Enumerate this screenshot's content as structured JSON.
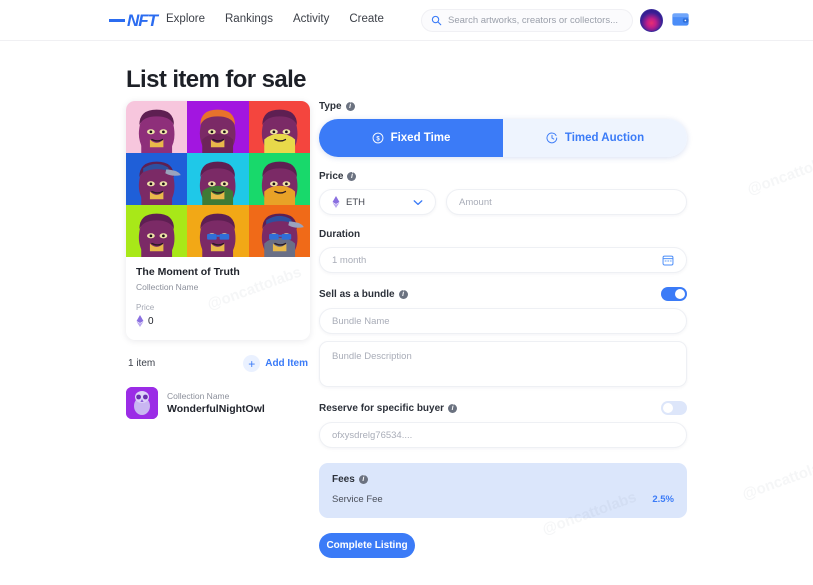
{
  "header": {
    "logo": "NFT",
    "nav": [
      {
        "label": "Explore"
      },
      {
        "label": "Rankings"
      },
      {
        "label": "Activity"
      },
      {
        "label": "Create"
      }
    ],
    "search": {
      "placeholder": "Search artworks, creators or collectors...",
      "value": ""
    },
    "icons": {
      "search": "search-icon",
      "avatar": "avatar",
      "wallet": "wallet-icon"
    }
  },
  "page_title": "List item for sale",
  "card": {
    "title": "The Moment of Truth",
    "collection": "Collection Name",
    "price_label": "Price",
    "price_value": "0",
    "tiles": [
      {
        "bg": "#f7c6dd",
        "skin": "#8e2f7a",
        "hair": "#5e1f52",
        "shirt": "#8e2f7a",
        "accent": "#e8b94a",
        "hat": null,
        "glasses": null
      },
      {
        "bg": "#a216e0",
        "skin": "#7b2a66",
        "hair": "#e8722c",
        "shirt": "#6d2459",
        "accent": "#e8b94a",
        "hat": null,
        "glasses": null
      },
      {
        "bg": "#f4453e",
        "skin": "#7b2a66",
        "hair": "#5e1f52",
        "shirt": "#e8d94a",
        "accent": "#e8d94a",
        "hat": null,
        "glasses": null
      },
      {
        "bg": "#1f5fd8",
        "skin": "#7b2a66",
        "hair": "#5e1f52",
        "shirt": "#7b2a66",
        "accent": "#e8b94a",
        "hat": "#2f4f9e",
        "glasses": null
      },
      {
        "bg": "#1fc8e8",
        "skin": "#7b2a66",
        "hair": "#5e1f52",
        "shirt": "#3f7a35",
        "accent": "#e8b94a",
        "hat": null,
        "glasses": null
      },
      {
        "bg": "#18d96b",
        "skin": "#7b2a66",
        "hair": "#5e1f52",
        "shirt": "#e8a227",
        "accent": "#e8a227",
        "hat": null,
        "glasses": null
      },
      {
        "bg": "#a8e818",
        "skin": "#7b2a66",
        "hair": "#5e1f52",
        "shirt": "#7b2a66",
        "accent": "#e8b94a",
        "hat": null,
        "glasses": null
      },
      {
        "bg": "#f2a816",
        "skin": "#7b2a66",
        "hair": "#5e1f52",
        "shirt": "#7b2a66",
        "accent": "#e8b94a",
        "hat": null,
        "glasses": "#2f6fd8"
      },
      {
        "bg": "#f06a18",
        "skin": "#7b2a66",
        "hair": "#5e1f52",
        "shirt": "#6a6f86",
        "accent": "#e8b94a",
        "hat": "#2f4f9e",
        "glasses": "#2f6fd8"
      }
    ]
  },
  "items": {
    "count_label": "1 item",
    "add_label": "Add Item",
    "add_icon": "plus-icon",
    "list": [
      {
        "collection": "Collection Name",
        "name": "WonderfulNightOwl"
      }
    ]
  },
  "form": {
    "type": {
      "label": "Type",
      "options": [
        {
          "label": "Fixed Time",
          "icon": "dollar-circle-icon",
          "active": true
        },
        {
          "label": "Timed Auction",
          "icon": "clock-icon",
          "active": false
        }
      ]
    },
    "price": {
      "label": "Price",
      "currency": "ETH",
      "currency_icon": "ethereum-icon",
      "chevron_icon": "chevron-down-icon",
      "amount_placeholder": "Amount",
      "amount_value": ""
    },
    "duration": {
      "label": "Duration",
      "placeholder": "1 month",
      "value": "",
      "icon": "calendar-icon"
    },
    "bundle": {
      "label": "Sell as a bundle",
      "toggle_on": true,
      "name_placeholder": "Bundle Name",
      "name_value": "",
      "description_placeholder": "Bundle Description",
      "description_value": ""
    },
    "reserve": {
      "label": "Reserve for specific buyer",
      "toggle_on": false,
      "address_placeholder": "ofxysdrelg76534....",
      "address_value": ""
    },
    "fees": {
      "label": "Fees",
      "rows": [
        {
          "name": "Service Fee",
          "value": "2.5%"
        }
      ]
    },
    "submit_label": "Complete Listing"
  },
  "colors": {
    "accent": "#3b7bf7",
    "accent_light": "#eef4fe",
    "fees_bg": "#dbe6fb",
    "text_dark": "#21242c",
    "text_muted": "#8c909b"
  },
  "watermarks": [
    "@oncattolabs",
    "@oncattolabs",
    "@oncattolabs",
    "@oncattolabs"
  ]
}
